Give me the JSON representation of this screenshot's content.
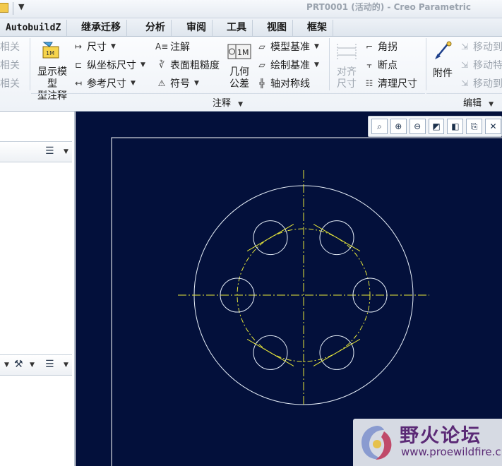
{
  "window": {
    "title": "PRT0001 (活动的) - Creo Parametric"
  },
  "colors": {
    "canvas_bg": "#03103b",
    "sketch_white": "#e6eef8",
    "centerline_yellow": "#e8e83a",
    "sheet_border": "#ffffff",
    "watermark_text": "#5b2a76"
  },
  "menu_tabs": [
    "AutobuildZ",
    "继承迁移",
    "分析",
    "审阅",
    "工具",
    "视图",
    "框架"
  ],
  "ribbon": {
    "left_cut_items": [
      "相关",
      "相关",
      "相关"
    ],
    "show_model_annotation": "显示模型\n型注释",
    "dimension": "尺寸",
    "ordinate_dimension": "纵坐标尺寸",
    "reference_dimension": "参考尺寸",
    "note": "注解",
    "surface_finish": "表面粗糙度",
    "symbol": "符号",
    "geometric_tolerance": "几何\n公差",
    "model_datum": "模型基准",
    "draft_datum": "绘制基准",
    "axis_symmetry_line": "轴对称线",
    "align_dimension": "对齐\n尺寸",
    "angle_lean": "角拐",
    "breakpoint": "断点",
    "clean_dimension": "清理尺寸",
    "attachment": "附件",
    "move_to_1": "移动到",
    "move_special": "移动特",
    "move_to_2": "移动到",
    "group_annotate": "注释",
    "group_edit": "编辑"
  },
  "icons": {
    "show_model_annotation": "show-model-annotation-icon",
    "dimension": "dimension-icon",
    "ordinate_dimension": "ordinate-dimension-icon",
    "reference_dimension": "reference-dimension-icon",
    "note": "note-icon",
    "surface_finish": "surface-finish-icon",
    "symbol": "symbol-icon",
    "geometric_tolerance": "geometric-tolerance-icon",
    "model_datum": "model-datum-icon",
    "draft_datum": "draft-datum-icon",
    "axis_symmetry": "axis-symmetry-icon",
    "align_dimension": "align-dimension-icon",
    "angle_lean": "jog-icon",
    "breakpoint": "breakpoint-icon",
    "clean_dimension": "clean-dimension-icon",
    "attachment": "attachment-icon",
    "zoom_fit": "refit-icon",
    "zoom_in": "zoom-in-icon",
    "zoom_out": "zoom-out-icon",
    "repaint": "repaint-icon",
    "display_style": "display-style-icon",
    "saved_views": "saved-views-icon",
    "datum_display": "datum-display-icon"
  },
  "watermark": {
    "brand": "野火论坛",
    "url": "www.proewildfire.cn"
  }
}
